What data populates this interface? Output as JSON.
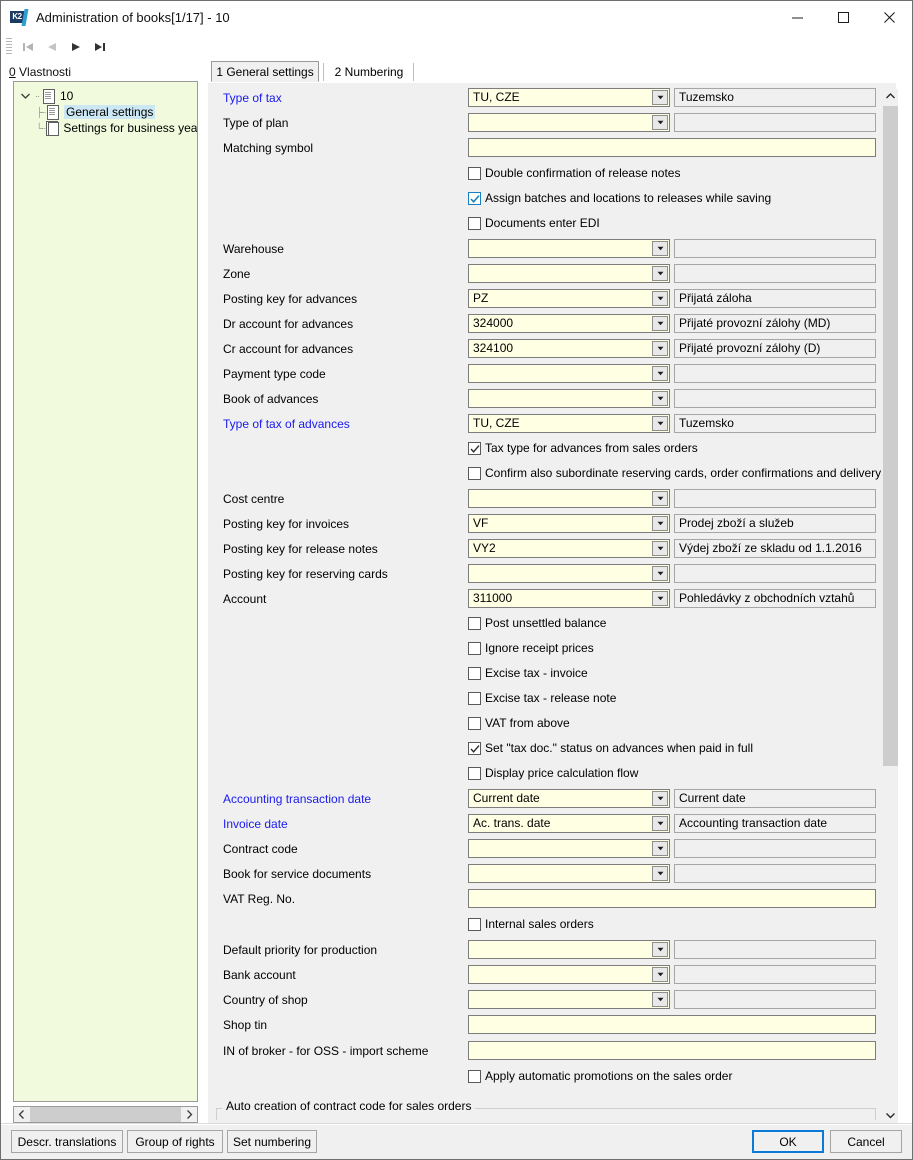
{
  "window": {
    "title": "Administration of books[1/17] - 10",
    "logo_text": "K2",
    "minimize": "—",
    "maximize": "□",
    "close": "✕"
  },
  "nav": {
    "first": "first-record",
    "prev": "previous-record",
    "next": "next-record",
    "last": "last-record"
  },
  "sidebar": {
    "title_underline": "0",
    "title": " Vlastnosti",
    "nodes": [
      {
        "label": "10",
        "level": 1,
        "icon": "document-icon",
        "selected": false,
        "expander": "⌄"
      },
      {
        "label": "General settings",
        "level": 2,
        "icon": "document-icon",
        "selected": true,
        "expander": ""
      },
      {
        "label": "Settings for business years",
        "level": 2,
        "icon": "documents-icon",
        "selected": false,
        "expander": ""
      }
    ]
  },
  "tabs": [
    {
      "label": "1 General settings",
      "active": true
    },
    {
      "label": "2 Numbering",
      "active": false
    }
  ],
  "form": {
    "rows": [
      {
        "kind": "combo",
        "label": "Type of tax",
        "blue": true,
        "value": "TU, CZE",
        "desc": "Tuzemsko"
      },
      {
        "kind": "combo",
        "label": "Type of plan",
        "blue": false,
        "value": "",
        "desc": ""
      },
      {
        "kind": "wide",
        "label": "Matching symbol",
        "blue": false,
        "value": ""
      },
      {
        "kind": "check",
        "label": "Double confirmation of release notes",
        "checked": false,
        "style": "none"
      },
      {
        "kind": "check",
        "label": "Assign batches and locations to releases while saving",
        "checked": true,
        "style": "blue"
      },
      {
        "kind": "check",
        "label": "Documents enter EDI",
        "checked": false,
        "style": "none"
      },
      {
        "kind": "combo",
        "label": "Warehouse",
        "blue": false,
        "value": "",
        "desc": ""
      },
      {
        "kind": "combo",
        "label": "Zone",
        "blue": false,
        "value": "",
        "desc": ""
      },
      {
        "kind": "combo",
        "label": "Posting key for advances",
        "blue": false,
        "value": "PZ",
        "desc": "Přijatá záloha"
      },
      {
        "kind": "combo",
        "label": "Dr account for advances",
        "blue": false,
        "value": "324000",
        "desc": "Přijaté provozní zálohy (MD)"
      },
      {
        "kind": "combo",
        "label": "Cr account for advances",
        "blue": false,
        "value": "324100",
        "desc": "Přijaté provozní zálohy (D)"
      },
      {
        "kind": "combo",
        "label": "Payment type code",
        "blue": false,
        "value": "",
        "desc": ""
      },
      {
        "kind": "combo",
        "label": "Book of advances",
        "blue": false,
        "value": "",
        "desc": ""
      },
      {
        "kind": "combo",
        "label": "Type of tax of advances",
        "blue": true,
        "value": "TU, CZE",
        "desc": "Tuzemsko"
      },
      {
        "kind": "check",
        "label": "Tax type for advances from sales orders",
        "checked": true,
        "style": "grey"
      },
      {
        "kind": "check",
        "label": "Confirm also subordinate reserving cards, order confirmations and delivery confirm",
        "checked": false,
        "style": "none"
      },
      {
        "kind": "combo",
        "label": "Cost centre",
        "blue": false,
        "value": "",
        "desc": ""
      },
      {
        "kind": "combo",
        "label": "Posting key for invoices",
        "blue": false,
        "value": "VF",
        "desc": "Prodej zboží a služeb"
      },
      {
        "kind": "combo",
        "label": "Posting key for release notes",
        "blue": false,
        "value": "VY2",
        "desc": "Výdej zboží ze skladu od 1.1.2016"
      },
      {
        "kind": "combo",
        "label": "Posting key for reserving cards",
        "blue": false,
        "value": "",
        "desc": ""
      },
      {
        "kind": "combo",
        "label": "Account",
        "blue": false,
        "value": "311000",
        "desc": "Pohledávky z obchodních vztahů"
      },
      {
        "kind": "check",
        "label": "Post unsettled balance",
        "checked": false,
        "style": "none"
      },
      {
        "kind": "check",
        "label": "Ignore receipt prices",
        "checked": false,
        "style": "none"
      },
      {
        "kind": "check",
        "label": "Excise tax - invoice",
        "checked": false,
        "style": "none"
      },
      {
        "kind": "check",
        "label": "Excise tax - release note",
        "checked": false,
        "style": "none"
      },
      {
        "kind": "check",
        "label": "VAT from above",
        "checked": false,
        "style": "none"
      },
      {
        "kind": "check",
        "label": "Set \"tax doc.\" status on advances when paid in full",
        "checked": true,
        "style": "grey"
      },
      {
        "kind": "check",
        "label": "Display price calculation flow",
        "checked": false,
        "style": "none"
      },
      {
        "kind": "combo",
        "label": "Accounting transaction date",
        "blue": true,
        "value": "Current date",
        "desc": "Current date"
      },
      {
        "kind": "combo",
        "label": "Invoice date",
        "blue": true,
        "value": "Ac. trans. date",
        "desc": "Accounting transaction date"
      },
      {
        "kind": "combo",
        "label": "Contract code",
        "blue": false,
        "value": "",
        "desc": ""
      },
      {
        "kind": "combo",
        "label": "Book for service documents",
        "blue": false,
        "value": "",
        "desc": ""
      },
      {
        "kind": "wide",
        "label": "VAT Reg. No.",
        "blue": false,
        "value": ""
      },
      {
        "kind": "check",
        "label": "Internal sales orders",
        "checked": false,
        "style": "none"
      },
      {
        "kind": "combo",
        "label": "Default priority for production",
        "blue": false,
        "value": "",
        "desc": ""
      },
      {
        "kind": "combo",
        "label": "Bank account",
        "blue": false,
        "value": "",
        "desc": ""
      },
      {
        "kind": "combo",
        "label": "Country of shop",
        "blue": false,
        "value": "",
        "desc": ""
      },
      {
        "kind": "wide",
        "label": "Shop tin",
        "blue": false,
        "value": ""
      },
      {
        "kind": "wide",
        "label": "IN of broker - for OSS - import scheme",
        "blue": false,
        "value": ""
      },
      {
        "kind": "check",
        "label": "Apply automatic promotions on the sales order",
        "checked": false,
        "style": "none"
      }
    ],
    "groupbox_title": "Auto creation of contract code for sales orders"
  },
  "buttons": {
    "descr_translations": "Descr. translations",
    "group_of_rights": "Group of rights",
    "set_numbering": "Set numbering",
    "ok": "OK",
    "cancel": "Cancel"
  },
  "colors": {
    "accent": "#1a1aee",
    "field_bg": "#ffffe4",
    "tree_bg": "#f2fadd",
    "selection": "#cce8f4",
    "primary_border": "#0b7ad6"
  }
}
